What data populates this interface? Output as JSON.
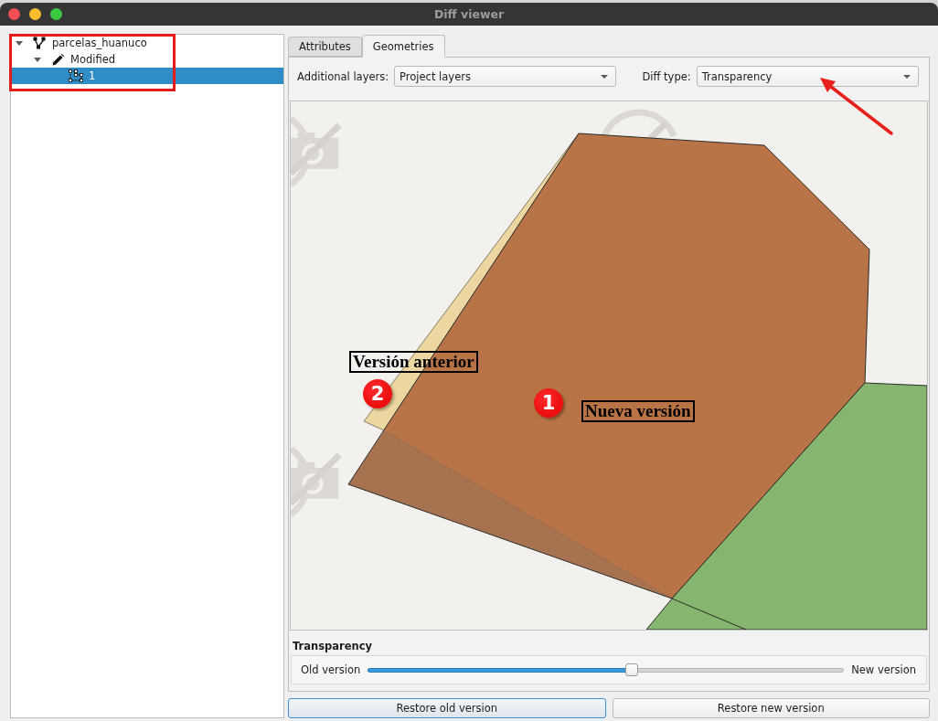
{
  "window": {
    "title": "Diff viewer"
  },
  "tree": [
    {
      "label": "parcelas_huanuco",
      "kind": "layer",
      "expanded": true,
      "selected": false,
      "children": [
        {
          "label": "Modified",
          "kind": "edit",
          "expanded": true,
          "selected": false,
          "children": [
            {
              "label": "1",
              "kind": "feature",
              "selected": true
            }
          ]
        }
      ]
    }
  ],
  "tabs": [
    {
      "label": "Attributes",
      "selected": false
    },
    {
      "label": "Geometries",
      "selected": true
    }
  ],
  "toolbar": {
    "fields": [
      {
        "label": "Additional layers:",
        "value": "Project layers"
      },
      {
        "label": "Diff type:",
        "value": "Transparency"
      }
    ]
  },
  "map": {
    "callouts": [
      {
        "label": "Versión anterior",
        "number": "2"
      },
      {
        "label": "Nueva versión",
        "number": "1"
      }
    ]
  },
  "transparency": {
    "title": "Transparency",
    "min_label": "Old version",
    "max_label": "New version",
    "level": 0.555
  },
  "buttons": [
    {
      "label": "Restore old version",
      "focused": true
    },
    {
      "label": "Restore new version",
      "focused": false
    }
  ]
}
